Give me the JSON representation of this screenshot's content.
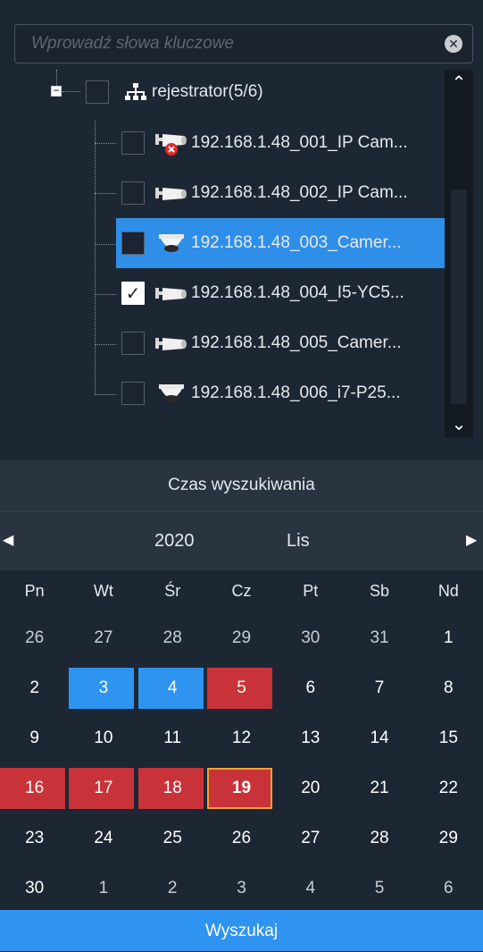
{
  "search": {
    "placeholder": "Wprowadź słowa kluczowe",
    "value": "",
    "clear_icon": "clear-icon"
  },
  "tree": {
    "root": {
      "label": "rejestrator(5/6)",
      "checked": false,
      "icon": "network-icon"
    },
    "cameras": [
      {
        "label": "192.168.1.48_001_IP Cam...",
        "checked": false,
        "icon": "bullet-camera-offline-icon",
        "selected": false
      },
      {
        "label": "192.168.1.48_002_IP Cam...",
        "checked": false,
        "icon": "bullet-camera-icon",
        "selected": false
      },
      {
        "label": "192.168.1.48_003_Camer...",
        "checked": false,
        "icon": "dome-camera-icon",
        "selected": true
      },
      {
        "label": "192.168.1.48_004_I5-YC5...",
        "checked": true,
        "icon": "bullet-camera-icon",
        "selected": false
      },
      {
        "label": "192.168.1.48_005_Camer...",
        "checked": false,
        "icon": "bullet-camera-icon",
        "selected": false
      },
      {
        "label": "192.168.1.48_006_i7-P25...",
        "checked": false,
        "icon": "dome-camera-icon",
        "selected": false
      }
    ]
  },
  "search_time": {
    "title": "Czas wyszukiwania"
  },
  "calendar": {
    "year": "2020",
    "month": "Lis",
    "weekdays": [
      "Pn",
      "Wt",
      "Śr",
      "Cz",
      "Pt",
      "Sb",
      "Nd"
    ],
    "weeks": [
      [
        "26",
        "27",
        "28",
        "29",
        "30",
        "31",
        "1"
      ],
      [
        "2",
        "3",
        "4",
        "5",
        "6",
        "7",
        "8"
      ],
      [
        "9",
        "10",
        "11",
        "12",
        "13",
        "14",
        "15"
      ],
      [
        "16",
        "17",
        "18",
        "19",
        "20",
        "21",
        "22"
      ],
      [
        "23",
        "24",
        "25",
        "26",
        "27",
        "28",
        "29"
      ],
      [
        "30",
        "1",
        "2",
        "3",
        "4",
        "5",
        "6"
      ]
    ],
    "colors": {
      "blue": "#2f93f0",
      "red": "#c8333a",
      "today_border": "#f1a22c"
    }
  },
  "search_button": {
    "label": "Wyszukaj"
  }
}
